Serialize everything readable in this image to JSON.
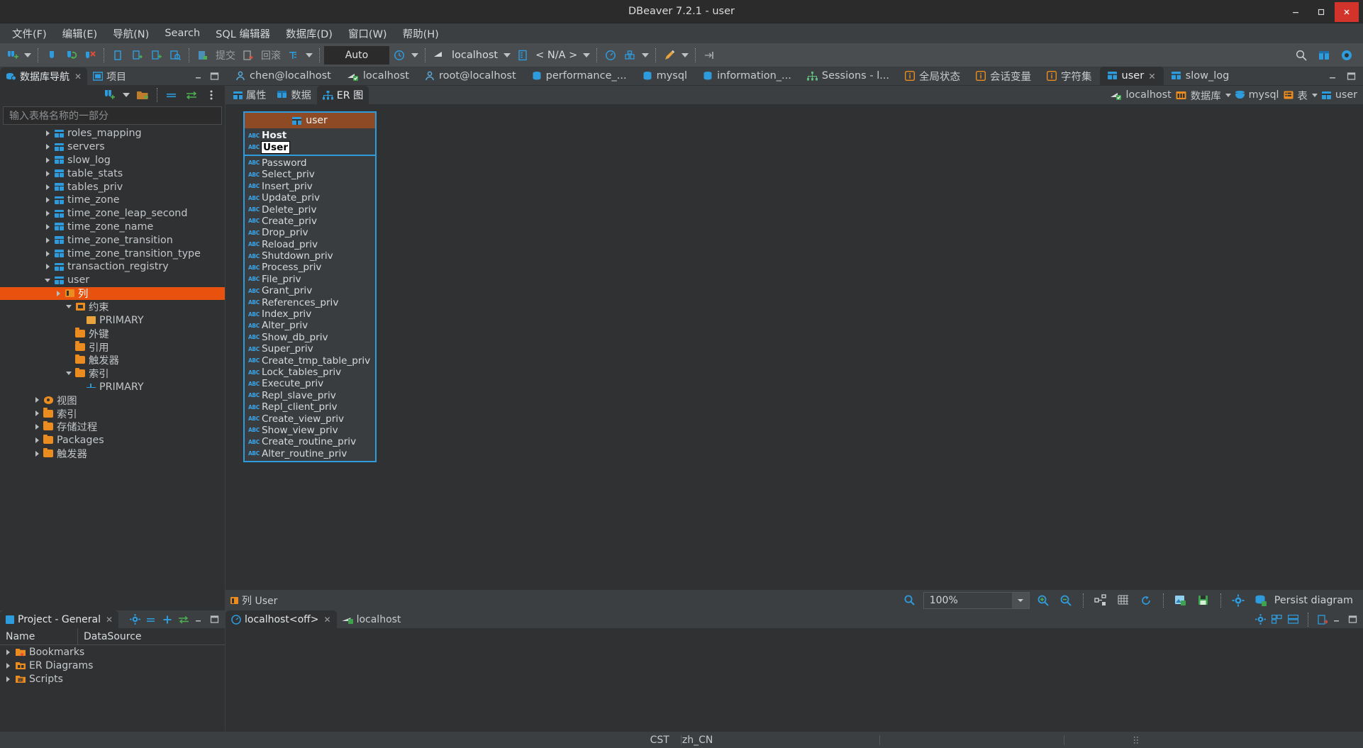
{
  "window": {
    "title": "DBeaver 7.2.1 - user",
    "minimize": "–",
    "maximize": "❐",
    "close": "✕"
  },
  "menubar": {
    "items": [
      {
        "label": "文件(F)",
        "name": "menu-file"
      },
      {
        "label": "编辑(E)",
        "name": "menu-edit"
      },
      {
        "label": "导航(N)",
        "name": "menu-navigate"
      },
      {
        "label": "Search",
        "name": "menu-search"
      },
      {
        "label": "SQL 编辑器",
        "name": "menu-sql-editor"
      },
      {
        "label": "数据库(D)",
        "name": "menu-database"
      },
      {
        "label": "窗口(W)",
        "name": "menu-window"
      },
      {
        "label": "帮助(H)",
        "name": "menu-help"
      }
    ]
  },
  "toolbar": {
    "commit_label": "提交",
    "rollback_label": "回滚",
    "auto_label": "Auto",
    "connection": "localhost",
    "database": "< N/A >"
  },
  "left_panel": {
    "tabs": [
      {
        "label": "数据库导航",
        "name": "panel-tab-db-navigator",
        "active": true,
        "closable": true
      },
      {
        "label": "项目",
        "name": "panel-tab-projects",
        "active": false,
        "closable": false
      }
    ],
    "search_placeholder": "输入表格名称的一部分",
    "tree": [
      {
        "label": "roles_mapping",
        "indent": 4,
        "arrow": "r",
        "icon": "table"
      },
      {
        "label": "servers",
        "indent": 4,
        "arrow": "r",
        "icon": "table"
      },
      {
        "label": "slow_log",
        "indent": 4,
        "arrow": "r",
        "icon": "table"
      },
      {
        "label": "table_stats",
        "indent": 4,
        "arrow": "r",
        "icon": "table"
      },
      {
        "label": "tables_priv",
        "indent": 4,
        "arrow": "r",
        "icon": "table"
      },
      {
        "label": "time_zone",
        "indent": 4,
        "arrow": "r",
        "icon": "table"
      },
      {
        "label": "time_zone_leap_second",
        "indent": 4,
        "arrow": "r",
        "icon": "table"
      },
      {
        "label": "time_zone_name",
        "indent": 4,
        "arrow": "r",
        "icon": "table"
      },
      {
        "label": "time_zone_transition",
        "indent": 4,
        "arrow": "r",
        "icon": "table"
      },
      {
        "label": "time_zone_transition_type",
        "indent": 4,
        "arrow": "r",
        "icon": "table"
      },
      {
        "label": "transaction_registry",
        "indent": 4,
        "arrow": "r",
        "icon": "table"
      },
      {
        "label": "user",
        "indent": 4,
        "arrow": "d",
        "icon": "table"
      },
      {
        "label": "列",
        "indent": 5,
        "arrow": "r",
        "icon": "cols",
        "selected": true
      },
      {
        "label": "约束",
        "indent": 6,
        "arrow": "d",
        "icon": "cons"
      },
      {
        "label": "PRIMARY",
        "indent": 7,
        "arrow": "none",
        "icon": "key"
      },
      {
        "label": "外键",
        "indent": 6,
        "arrow": "none",
        "icon": "folder"
      },
      {
        "label": "引用",
        "indent": 6,
        "arrow": "none",
        "icon": "folder"
      },
      {
        "label": "触发器",
        "indent": 6,
        "arrow": "none",
        "icon": "folder"
      },
      {
        "label": "索引",
        "indent": 6,
        "arrow": "d",
        "icon": "folder"
      },
      {
        "label": "PRIMARY",
        "indent": 7,
        "arrow": "none",
        "icon": "idx"
      },
      {
        "label": "视图",
        "indent": 3,
        "arrow": "r",
        "icon": "eye"
      },
      {
        "label": "索引",
        "indent": 3,
        "arrow": "r",
        "icon": "folder"
      },
      {
        "label": "存储过程",
        "indent": 3,
        "arrow": "r",
        "icon": "folder"
      },
      {
        "label": "Packages",
        "indent": 3,
        "arrow": "r",
        "icon": "folder"
      },
      {
        "label": "触发器",
        "indent": 3,
        "arrow": "r",
        "icon": "folder"
      }
    ]
  },
  "editor": {
    "tabs": [
      {
        "label": "chen@localhost",
        "icon": "user-icon",
        "name": "editor-tab-chen-localhost",
        "active": false
      },
      {
        "label": "localhost",
        "icon": "connection-icon",
        "name": "editor-tab-localhost-sql",
        "active": false
      },
      {
        "label": "root@localhost",
        "icon": "user-icon",
        "name": "editor-tab-root-localhost",
        "active": false
      },
      {
        "label": "performance_...",
        "icon": "db-icon",
        "name": "editor-tab-performance-schema",
        "active": false
      },
      {
        "label": "mysql",
        "icon": "db-icon",
        "name": "editor-tab-mysql",
        "active": false
      },
      {
        "label": "information_...",
        "icon": "db-icon",
        "name": "editor-tab-information-schema",
        "active": false
      },
      {
        "label": "Sessions - l...",
        "icon": "sessions-icon",
        "name": "editor-tab-sessions",
        "active": false
      },
      {
        "label": "全局状态",
        "icon": "info-icon",
        "name": "editor-tab-global-status",
        "active": false
      },
      {
        "label": "会话变量",
        "icon": "info-icon",
        "name": "editor-tab-session-variables",
        "active": false
      },
      {
        "label": "字符集",
        "icon": "info-icon",
        "name": "editor-tab-charsets",
        "active": false
      },
      {
        "label": "user",
        "icon": "table-icon",
        "name": "editor-tab-user",
        "active": true,
        "closable": true
      },
      {
        "label": "slow_log",
        "icon": "table-icon",
        "name": "editor-tab-slow-log",
        "active": false
      }
    ],
    "subtabs": [
      {
        "label": "属性",
        "name": "subtab-properties",
        "active": false
      },
      {
        "label": "数据",
        "name": "subtab-data",
        "active": false
      },
      {
        "label": "ER 图",
        "name": "subtab-er-diagram",
        "active": true
      }
    ],
    "breadcrumb": [
      {
        "label": "localhost",
        "icon": "connection-icon",
        "caret": false
      },
      {
        "label": "数据库",
        "icon": "databases-icon",
        "caret": true
      },
      {
        "label": "mysql",
        "icon": "db-icon",
        "caret": false
      },
      {
        "label": "表",
        "icon": "tables-icon",
        "caret": true
      },
      {
        "label": "user",
        "icon": "table-icon",
        "caret": false
      }
    ]
  },
  "er_diagram": {
    "table_name": "user",
    "key_columns": [
      "Host",
      "User"
    ],
    "editing_column": "User",
    "columns": [
      "Password",
      "Select_priv",
      "Insert_priv",
      "Update_priv",
      "Delete_priv",
      "Create_priv",
      "Drop_priv",
      "Reload_priv",
      "Shutdown_priv",
      "Process_priv",
      "File_priv",
      "Grant_priv",
      "References_priv",
      "Index_priv",
      "Alter_priv",
      "Show_db_priv",
      "Super_priv",
      "Create_tmp_table_priv",
      "Lock_tables_priv",
      "Execute_priv",
      "Repl_slave_priv",
      "Repl_client_priv",
      "Create_view_priv",
      "Show_view_priv",
      "Create_routine_priv",
      "Alter_routine_priv"
    ],
    "column_type_badge": "ABC",
    "status": {
      "selection_label": "列 User",
      "zoom_value": "100%",
      "persist_label": "Persist diagram"
    }
  },
  "bottom": {
    "project_panel": {
      "tab_label": "Project - General",
      "columns": [
        "Name",
        "DataSource"
      ],
      "rows": [
        {
          "name": "Bookmarks",
          "datasource": "",
          "icon": "bookmark-folder-icon"
        },
        {
          "name": "ER Diagrams",
          "datasource": "",
          "icon": "er-folder-icon"
        },
        {
          "name": "Scripts",
          "datasource": "",
          "icon": "scripts-folder-icon"
        }
      ]
    },
    "right_panel": {
      "tabs": [
        {
          "label": "localhost<off>",
          "name": "bottom-tab-localhost-off",
          "active": true,
          "closable": true
        },
        {
          "label": "localhost",
          "name": "bottom-tab-localhost",
          "active": false,
          "closable": false
        }
      ]
    }
  },
  "statusbar": {
    "timezone": "CST",
    "locale": "zh_CN"
  },
  "colors": {
    "accent_orange": "#e8520e",
    "accent_blue": "#2e9bdd",
    "er_header": "#8e4a25",
    "panel_bg": "#2f3133",
    "chrome_bg": "#3c3f41",
    "toolbar_bg": "#4a4d4f"
  }
}
